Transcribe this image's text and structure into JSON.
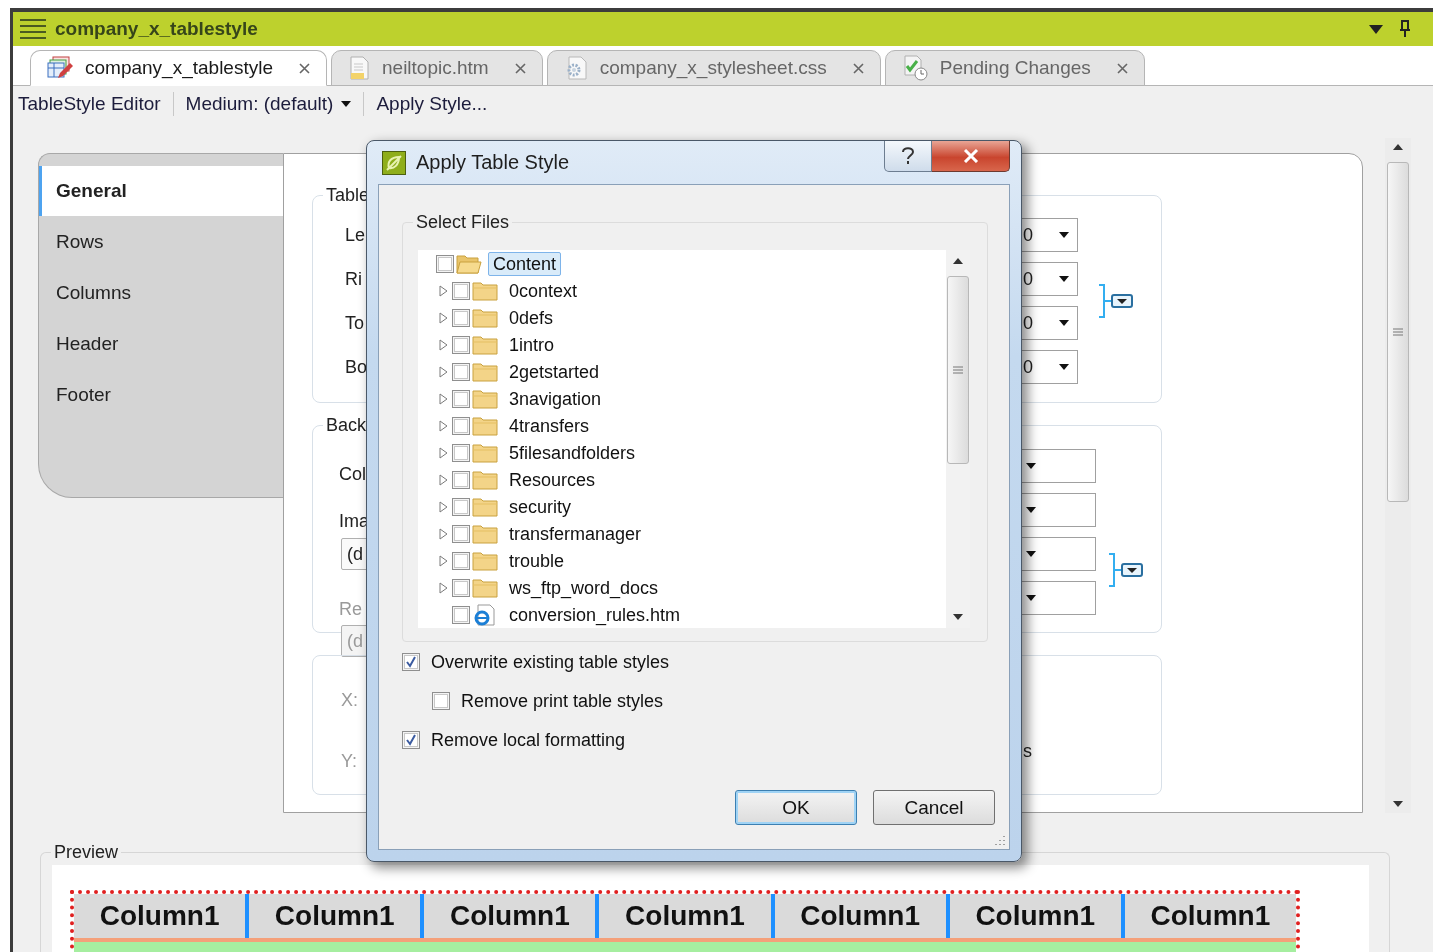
{
  "panel": {
    "title": "company_x_tablestyle"
  },
  "tabs": [
    {
      "label": "company_x_tablestyle",
      "kind": "tablestyle",
      "selected": true
    },
    {
      "label": "neiltopic.htm",
      "kind": "html",
      "selected": false
    },
    {
      "label": "company_x_stylesheet.css",
      "kind": "css",
      "selected": false
    },
    {
      "label": "Pending Changes",
      "kind": "changes",
      "selected": false
    }
  ],
  "toolbar": {
    "title": "TableStyle Editor",
    "style_dropdown": "Medium: (default)",
    "apply_button": "Apply Style..."
  },
  "nav": [
    {
      "label": "General",
      "selected": true
    },
    {
      "label": "Rows",
      "selected": false
    },
    {
      "label": "Columns",
      "selected": false
    },
    {
      "label": "Header",
      "selected": false
    },
    {
      "label": "Footer",
      "selected": false
    }
  ],
  "table_group": {
    "title": "Table",
    "rows": [
      {
        "label": "Le",
        "value": "0"
      },
      {
        "label": "Ri",
        "value": "0"
      },
      {
        "label": "To",
        "value": "0"
      },
      {
        "label": "Bo",
        "value": "0"
      }
    ]
  },
  "background_group": {
    "title": "Back",
    "color_label": "Col",
    "image_label": "Ima",
    "image_value": "(d",
    "repeat_label": "Re",
    "repeat_value": "(d",
    "repeat_disabled": true
  },
  "position_group": {
    "x_label": "X:",
    "y_label": "Y:",
    "disabled": true,
    "option_text": "s"
  },
  "dialog": {
    "title": "Apply Table Style",
    "files_title": "Select Files",
    "tree": {
      "label": "Content",
      "kind": "folder",
      "checked": false,
      "selected": true,
      "children": [
        {
          "label": "0context",
          "kind": "folder",
          "checked": false,
          "selected": false,
          "expanded": false
        },
        {
          "label": "0defs",
          "kind": "folder",
          "checked": false,
          "selected": false,
          "expanded": false
        },
        {
          "label": "1intro",
          "kind": "folder",
          "checked": false,
          "selected": false,
          "expanded": false
        },
        {
          "label": "2getstarted",
          "kind": "folder",
          "checked": false,
          "selected": false,
          "expanded": false
        },
        {
          "label": "3navigation",
          "kind": "folder",
          "checked": false,
          "selected": false,
          "expanded": false
        },
        {
          "label": "4transfers",
          "kind": "folder",
          "checked": false,
          "selected": false,
          "expanded": false
        },
        {
          "label": "5filesandfolders",
          "kind": "folder",
          "checked": false,
          "selected": false,
          "expanded": false
        },
        {
          "label": "Resources",
          "kind": "folder",
          "checked": false,
          "selected": false,
          "expanded": false
        },
        {
          "label": "security",
          "kind": "folder",
          "checked": false,
          "selected": false,
          "expanded": false
        },
        {
          "label": "transfermanager",
          "kind": "folder",
          "checked": false,
          "selected": false,
          "expanded": false
        },
        {
          "label": "trouble",
          "kind": "folder",
          "checked": false,
          "selected": false,
          "expanded": false
        },
        {
          "label": "ws_ftp_word_docs",
          "kind": "folder",
          "checked": false,
          "selected": false,
          "expanded": false
        },
        {
          "label": "conversion_rules.htm",
          "kind": "file",
          "checked": false,
          "selected": false
        }
      ]
    },
    "options": [
      {
        "label": "Overwrite existing table styles",
        "checked": true,
        "children": [
          {
            "label": "Remove print table styles",
            "checked": false
          }
        ]
      },
      {
        "label": "Remove local formatting",
        "checked": true
      }
    ],
    "buttons": [
      {
        "label": "OK",
        "default": true
      },
      {
        "label": "Cancel",
        "default": false
      }
    ]
  },
  "preview": {
    "title": "Preview",
    "columns": [
      "Column1",
      "Column1",
      "Column1",
      "Column1",
      "Column1",
      "Column1",
      "Column1"
    ]
  }
}
